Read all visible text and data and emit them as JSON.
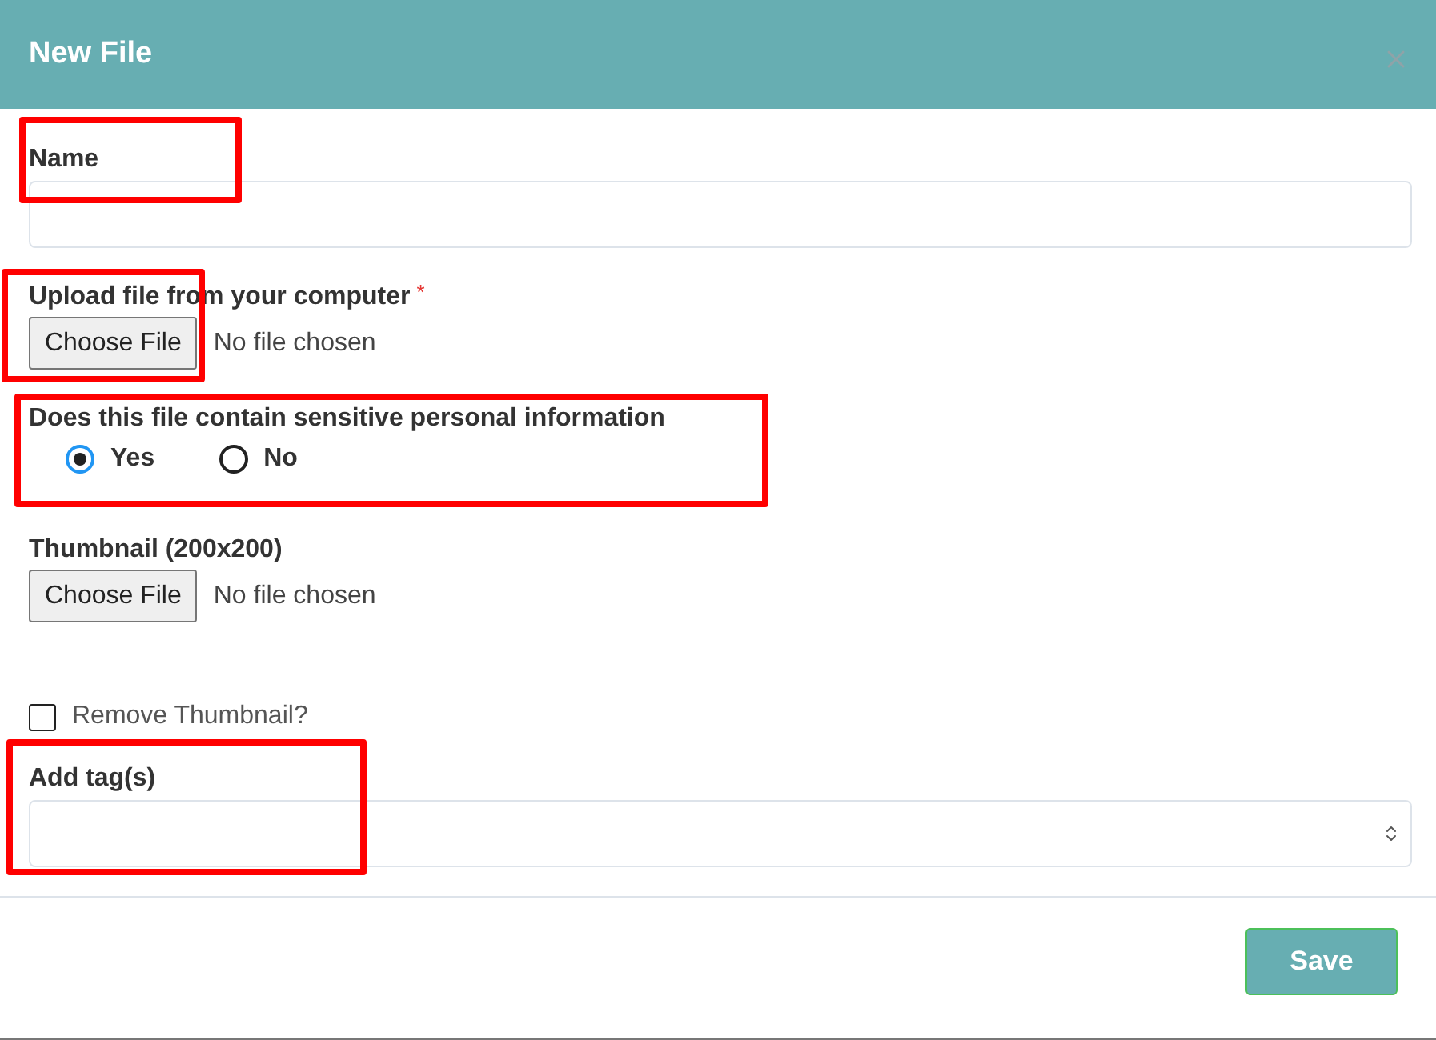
{
  "dialog": {
    "title": "New File"
  },
  "fields": [
    {
      "kind": "text",
      "label": "Name",
      "highlighted": true
    },
    {
      "kind": "file",
      "label": "Upload file from your computer",
      "required_mark": "*",
      "button": "Choose File",
      "status": "No file chosen",
      "highlighted": true
    },
    {
      "kind": "radio",
      "label": "Does this file contain sensitive personal information",
      "highlighted": true,
      "options": [
        {
          "label": "Yes",
          "selected": true
        },
        {
          "label": "No",
          "selected": false
        }
      ]
    },
    {
      "kind": "file",
      "label": "Thumbnail (200x200)",
      "button": "Choose File",
      "status": "No file chosen",
      "highlighted": false
    },
    {
      "kind": "checkbox",
      "label": "Remove Thumbnail?",
      "checked": false,
      "highlighted": false
    },
    {
      "kind": "select",
      "label": "Add tag(s)",
      "highlighted": true
    }
  ],
  "footer": {
    "button": "Save"
  }
}
